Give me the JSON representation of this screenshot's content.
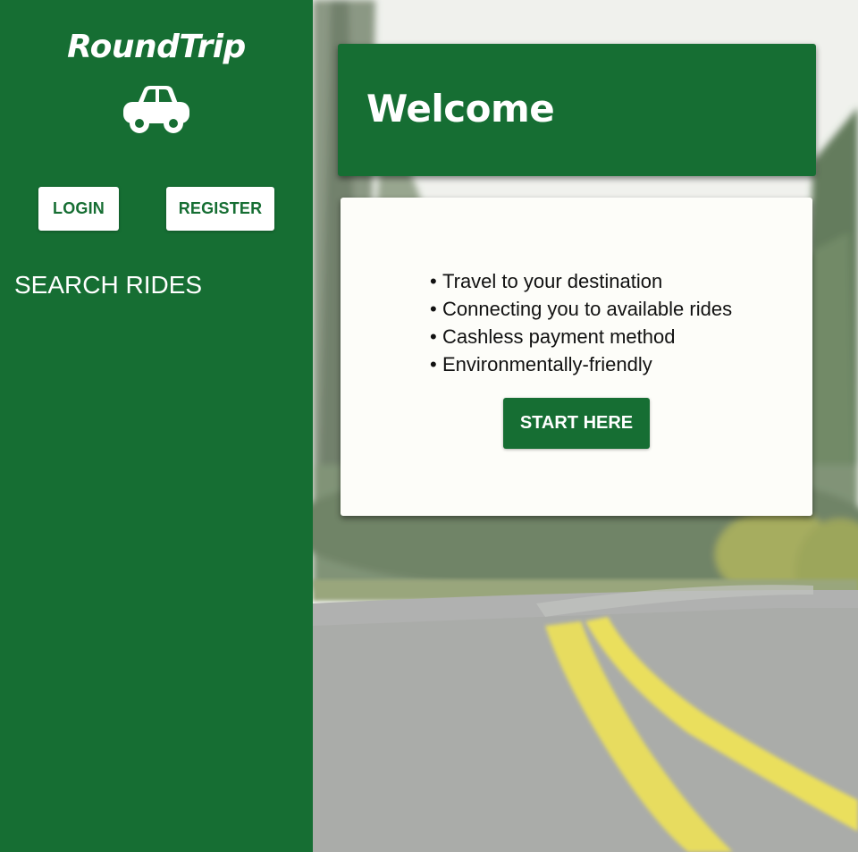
{
  "sidebar": {
    "brand": "RoundTrip",
    "car_icon": "car-icon",
    "login_label": "LOGIN",
    "register_label": "REGISTER",
    "search_rides_label": "SEARCH RIDES"
  },
  "main": {
    "welcome_title": "Welcome",
    "features": [
      "Travel to your destination",
      "Connecting you to available rides",
      "Cashless payment method",
      "Environmentally-friendly"
    ],
    "bullet": "•",
    "start_label": "START HERE"
  },
  "colors": {
    "brand_green": "#166e33",
    "card_background": "#fdfdf9",
    "text_on_green": "#ffffff"
  }
}
